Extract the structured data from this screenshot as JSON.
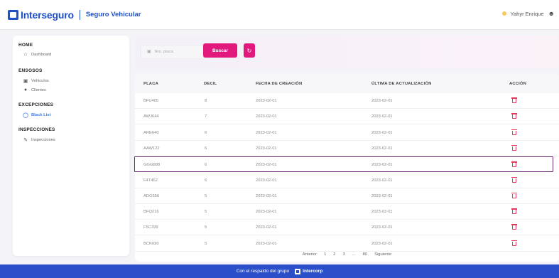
{
  "header": {
    "brand": "Interseguro",
    "product": "Seguro Vehicular",
    "user_name": "Yahyr Enrique"
  },
  "sidebar": {
    "sections": [
      {
        "title": "HOME",
        "items": [
          {
            "label": "Dashboard",
            "icon": "home-icon"
          }
        ]
      },
      {
        "title": "ENSOSOS",
        "items": [
          {
            "label": "Vehiculos",
            "icon": "car-icon"
          },
          {
            "label": "Clientes",
            "icon": "users-icon"
          }
        ]
      },
      {
        "title": "EXCEPCIONES",
        "items": [
          {
            "label": "Black List",
            "icon": "list-icon",
            "active": true
          }
        ]
      },
      {
        "title": "INSPECCIONES",
        "items": [
          {
            "label": "Inspecciones",
            "icon": "pen-icon"
          }
        ]
      }
    ]
  },
  "search": {
    "placeholder": "Nro. placa",
    "button_label": "Buscar",
    "refresh_icon": "refresh-icon"
  },
  "table": {
    "columns": [
      "PLACA",
      "DECIL",
      "FECHA DE CREACIÓN",
      "ÚLTIMA DE ACTUALIZACIÓN",
      "ACCIÓN"
    ],
    "rows": [
      {
        "placa": "BFU405",
        "decil": "8",
        "fecha_creacion": "2023-02-01",
        "ultima_actualizacion": "2023-02-01"
      },
      {
        "placa": "AWJ644",
        "decil": "7",
        "fecha_creacion": "2023-02-01",
        "ultima_actualizacion": "2023-02-01"
      },
      {
        "placa": "ARE640",
        "decil": "6",
        "fecha_creacion": "2023-02-01",
        "ultima_actualizacion": "2023-02-01"
      },
      {
        "placa": "AAW122",
        "decil": "6",
        "fecha_creacion": "2023-02-01",
        "ultima_actualizacion": "2023-02-01"
      },
      {
        "placa": "GGG888",
        "decil": "6",
        "fecha_creacion": "2023-02-01",
        "ultima_actualizacion": "2023-02-01",
        "highlighted": true
      },
      {
        "placa": "F4T462",
        "decil": "6",
        "fecha_creacion": "2023-02-01",
        "ultima_actualizacion": "2023-02-01"
      },
      {
        "placa": "ADO356",
        "decil": "5",
        "fecha_creacion": "2023-02-01",
        "ultima_actualizacion": "2023-02-01"
      },
      {
        "placa": "BFQ216",
        "decil": "5",
        "fecha_creacion": "2023-02-01",
        "ultima_actualizacion": "2023-02-01"
      },
      {
        "placa": "F5C339",
        "decil": "5",
        "fecha_creacion": "2023-02-01",
        "ultima_actualizacion": "2023-02-01"
      },
      {
        "placa": "BCK690",
        "decil": "5",
        "fecha_creacion": "2023-02-01",
        "ultima_actualizacion": "2023-02-01"
      }
    ]
  },
  "pagination": {
    "prev_label": "Anterior",
    "pages": [
      "1",
      "2",
      "3",
      "...",
      "80"
    ],
    "next_label": "Siguiente"
  },
  "footer": {
    "text": "Con el respaldo del grupo",
    "brand": "Intercorp"
  },
  "colors": {
    "brand_blue": "#1e50c8",
    "accent_pink": "#e1197d",
    "delete_red": "#e5395b",
    "highlight_border": "#6a2a6e",
    "footer_blue": "#2a4fc9"
  }
}
